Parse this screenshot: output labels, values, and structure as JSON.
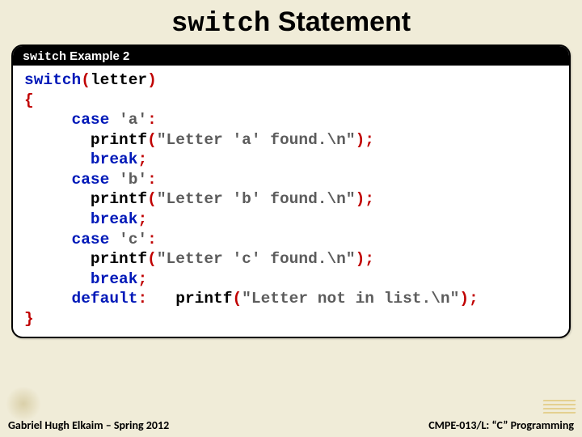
{
  "title": {
    "mono": "switch",
    "rest": " Statement"
  },
  "example": {
    "label_mono": "switch",
    "label_rest": " Example 2"
  },
  "code": {
    "l1": {
      "kw": "switch",
      "p1": "(",
      "id": "letter",
      "p2": ")"
    },
    "l2": {
      "p": "{"
    },
    "l3": {
      "kw": "case",
      "lit": "'a'",
      "p": ":"
    },
    "l4": {
      "id": "printf",
      "p1": "(",
      "str": "\"Letter 'a' found.\\n\"",
      "p2": ");"
    },
    "l5": {
      "kw": "break",
      "p": ";"
    },
    "l6": {
      "kw": "case",
      "lit": "'b'",
      "p": ":"
    },
    "l7": {
      "id": "printf",
      "p1": "(",
      "str": "\"Letter 'b' found.\\n\"",
      "p2": ");"
    },
    "l8": {
      "kw": "break",
      "p": ";"
    },
    "l9": {
      "kw": "case",
      "lit": "'c'",
      "p": ":"
    },
    "l10": {
      "id": "printf",
      "p1": "(",
      "str": "\"Letter 'c' found.\\n\"",
      "p2": ");"
    },
    "l11": {
      "kw": "break",
      "p": ";"
    },
    "l12": {
      "kw": "default",
      "p": ":",
      "id": "printf",
      "p1": "(",
      "str": "\"Letter not in list.\\n\"",
      "p2": ");"
    },
    "l13": {
      "p": "}"
    }
  },
  "footer": {
    "left": "Gabriel Hugh Elkaim – Spring 2012",
    "right": "CMPE-013/L: “C” Programming"
  }
}
